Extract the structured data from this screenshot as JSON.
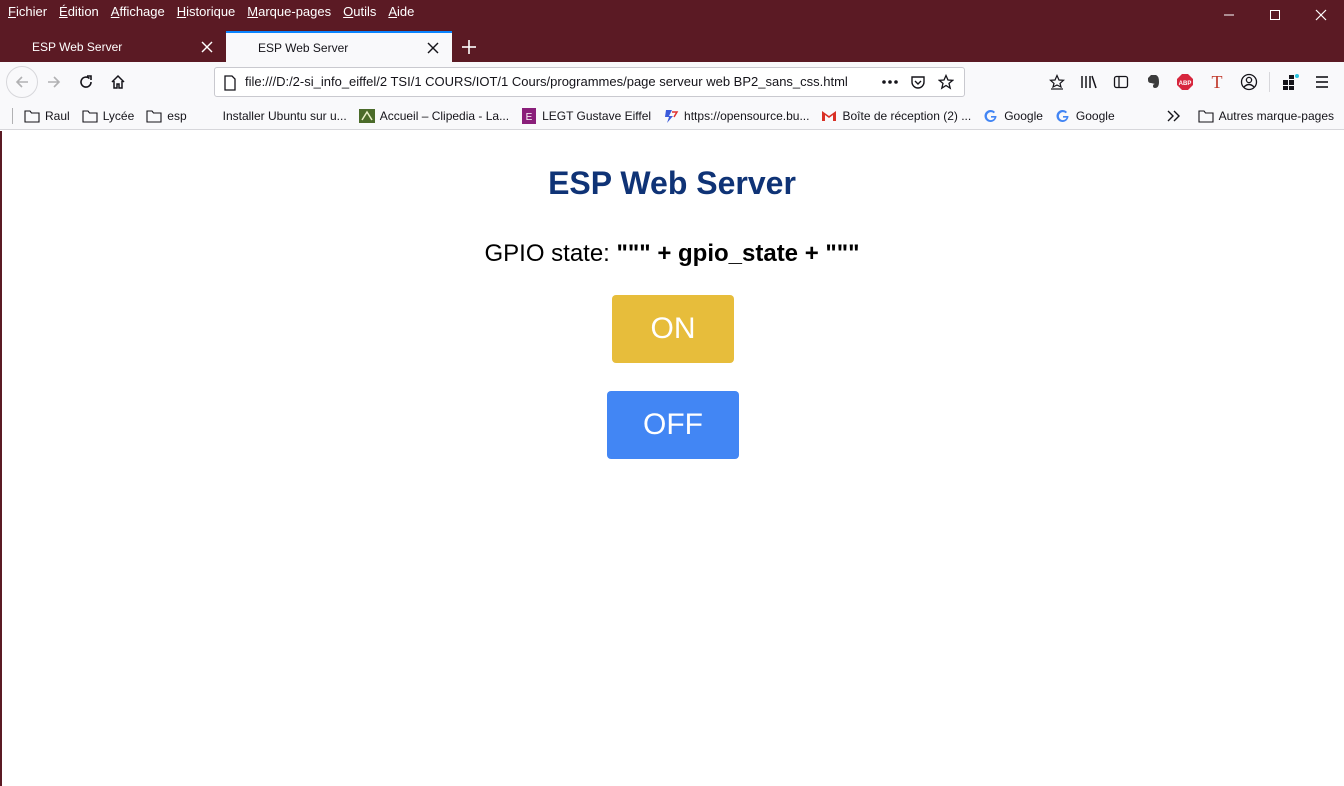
{
  "menu": [
    "Fichier",
    "Édition",
    "Affichage",
    "Historique",
    "Marque-pages",
    "Outils",
    "Aide"
  ],
  "tabs": [
    {
      "title": "ESP Web Server",
      "active": false
    },
    {
      "title": "ESP Web Server",
      "active": true
    }
  ],
  "url": "file:///D:/2-si_info_eiffel/2 TSI/1 COURS/IOT/1 Cours/programmes/page serveur web BP2_sans_css.html",
  "bookmarks": [
    {
      "label": "Raul",
      "icon": "folder-icon"
    },
    {
      "label": "Lycée",
      "icon": "folder-icon"
    },
    {
      "label": "esp",
      "icon": "folder-icon"
    },
    {
      "label": "Installer Ubuntu sur u...",
      "icon": "none"
    },
    {
      "label": "Accueil – Clipedia - La...",
      "icon": "clipedia-icon"
    },
    {
      "label": "LEGT Gustave Eiffel",
      "icon": "eiffel-icon"
    },
    {
      "label": "https://opensource.bu...",
      "icon": "opensource-icon"
    },
    {
      "label": "Boîte de réception (2) ...",
      "icon": "gmail-icon"
    },
    {
      "label": "Google",
      "icon": "google-icon"
    },
    {
      "label": "Google",
      "icon": "google-icon"
    }
  ],
  "other_bookmarks": "Autres marque-pages",
  "page": {
    "title": "ESP Web Server",
    "gpio_prefix": "GPIO state: ",
    "gpio_value": "\"\"\" + gpio_state + \"\"\"",
    "on_label": "ON",
    "off_label": "OFF"
  },
  "colors": {
    "titlebar": "#5b1a24",
    "heading": "#0f3376",
    "on_button": "#e7bd3b",
    "off_button": "#4286f4",
    "tab_accent": "#0a84ff"
  }
}
